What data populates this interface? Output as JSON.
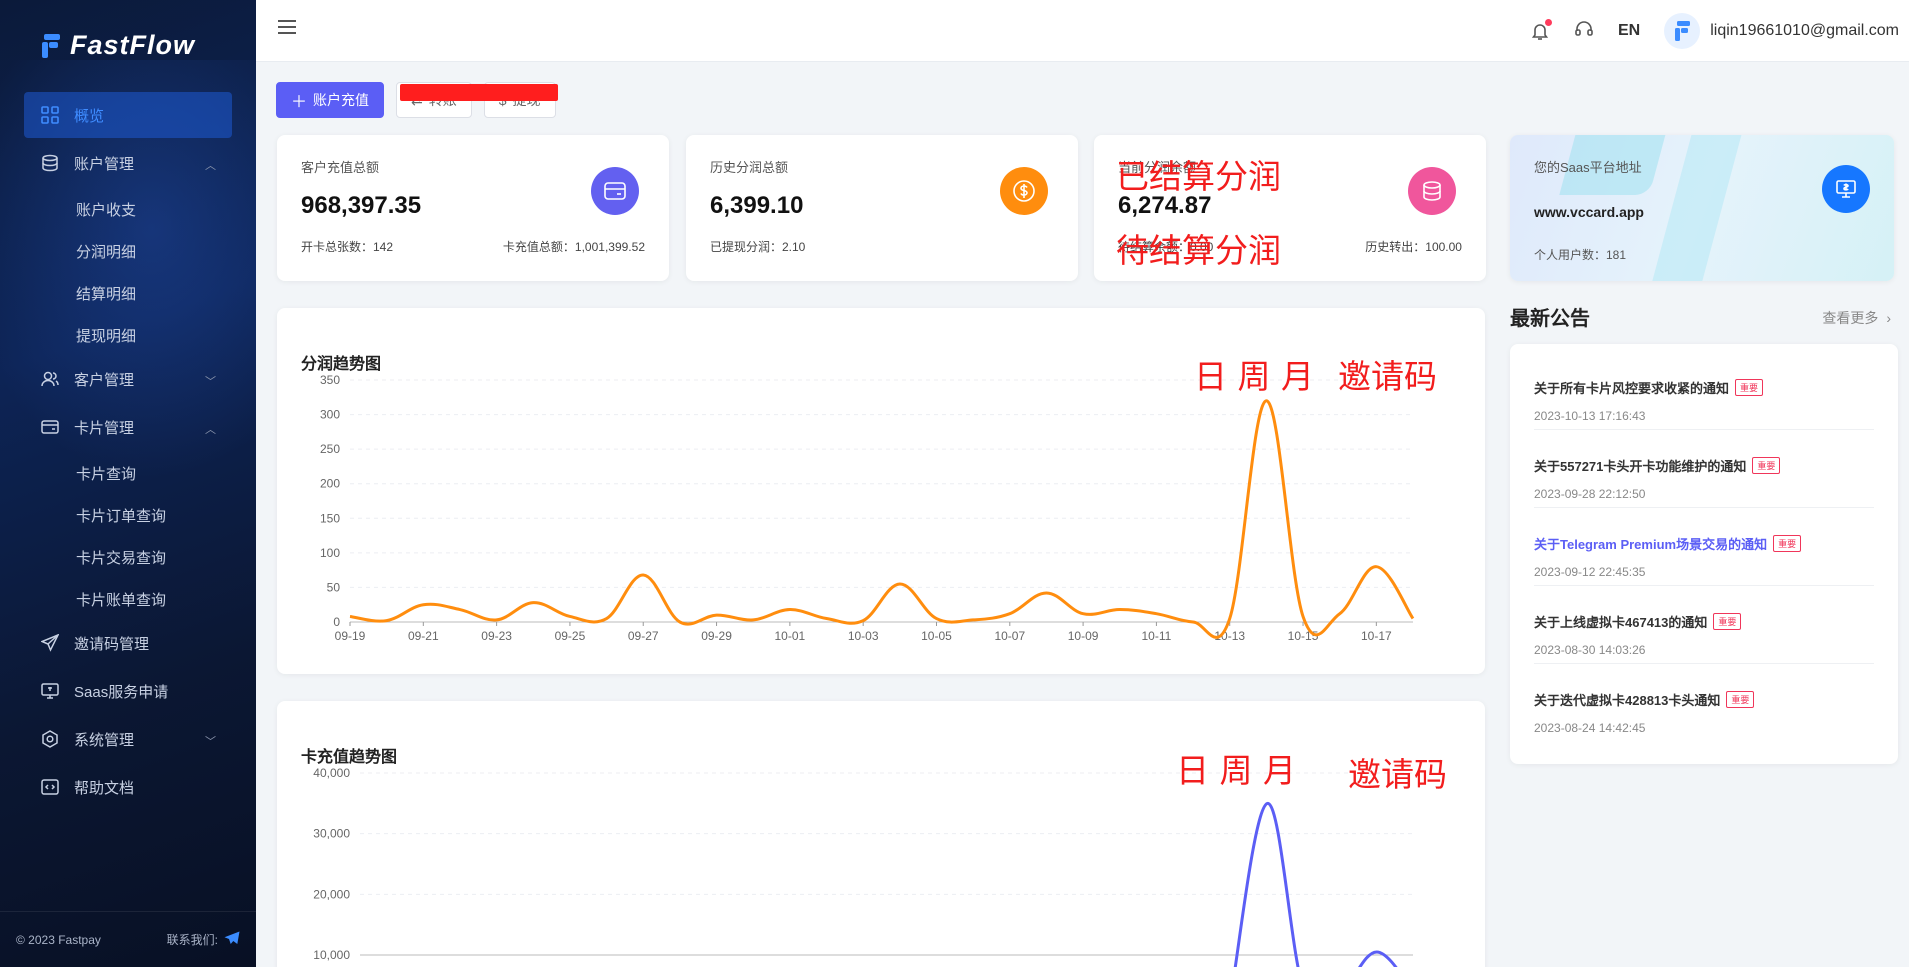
{
  "brand": {
    "name": "FastFlow"
  },
  "sidebar": {
    "items": [
      {
        "label": "概览",
        "icon": "dashboard-icon"
      },
      {
        "label": "账户管理",
        "icon": "database-icon",
        "expanded": true,
        "children": [
          "账户收支",
          "分润明细",
          "结算明细",
          "提现明细"
        ]
      },
      {
        "label": "客户管理",
        "icon": "users-icon",
        "expanded": false
      },
      {
        "label": "卡片管理",
        "icon": "card-icon",
        "expanded": true,
        "children": [
          "卡片查询",
          "卡片订单查询",
          "卡片交易查询",
          "卡片账单查询"
        ]
      },
      {
        "label": "邀请码管理",
        "icon": "send-icon"
      },
      {
        "label": "Saas服务申请",
        "icon": "monitor-icon"
      },
      {
        "label": "系统管理",
        "icon": "settings-icon",
        "expanded": false
      },
      {
        "label": "帮助文档",
        "icon": "code-icon"
      }
    ],
    "footer": {
      "copyright": "© 2023 Fastpay",
      "contact": "联系我们:"
    }
  },
  "topbar": {
    "lang": "EN",
    "user_email": "liqin19661010@gmail.com"
  },
  "actions": {
    "recharge": "账户充值",
    "transfer": "转账",
    "withdraw": "提现"
  },
  "stats": [
    {
      "label": "客户充值总额",
      "value": "968,397.35",
      "foot_left": "开卡总张数：142",
      "foot_right": "卡充值总额：1,001,399.52",
      "color": "#6360f0",
      "icon": "wallet-icon"
    },
    {
      "label": "历史分润总额",
      "value": "6,399.10",
      "foot_left": "已提现分润：2.10",
      "foot_right": "",
      "color": "#ff8d0e",
      "icon": "dollar-icon"
    },
    {
      "label": "当前分润余额",
      "value": "6,274.87",
      "foot_left": "待结算余额：0.00",
      "foot_right": "历史转出：100.00",
      "color": "#f0569c",
      "icon": "coins-icon"
    }
  ],
  "saas": {
    "label": "您的Saas平台地址",
    "url": "www.vccard.app",
    "users": "个人用户数：181"
  },
  "annotations": {
    "settled": "已结算分润",
    "pending": "待结算分润",
    "period_1": "日 周 月",
    "invite_1": "邀请码",
    "period_2": "日 周 月",
    "invite_2": "邀请码"
  },
  "notices": {
    "title": "最新公告",
    "more": "查看更多",
    "items": [
      {
        "title": "关于所有卡片风控要求收紧的通知",
        "tag": "重要",
        "date": "2023-10-13 17:16:43",
        "highlight": false
      },
      {
        "title": "关于557271卡头开卡功能维护的通知",
        "tag": "重要",
        "date": "2023-09-28 22:12:50",
        "highlight": false
      },
      {
        "title": "关于Telegram Premium场景交易的通知",
        "tag": "重要",
        "date": "2023-09-12 22:45:35",
        "highlight": true
      },
      {
        "title": "关于上线虚拟卡467413的通知",
        "tag": "重要",
        "date": "2023-08-30 14:03:26",
        "highlight": false
      },
      {
        "title": "关于迭代虚拟卡428813卡头通知",
        "tag": "重要",
        "date": "2023-08-24 14:42:45",
        "highlight": false
      }
    ]
  },
  "chart_data": [
    {
      "type": "line",
      "title": "分润趋势图",
      "color": "#ff8d0e",
      "ylim": [
        0,
        350
      ],
      "yticks": [
        0,
        50,
        100,
        150,
        200,
        250,
        300,
        350
      ],
      "xticks": [
        "09-19",
        "09-21",
        "09-23",
        "09-25",
        "09-27",
        "09-29",
        "10-01",
        "10-03",
        "10-05",
        "10-07",
        "10-09",
        "10-11",
        "10-13",
        "10-15",
        "10-17"
      ],
      "x": [
        "09-19",
        "09-20",
        "09-21",
        "09-22",
        "09-23",
        "09-24",
        "09-25",
        "09-26",
        "09-27",
        "09-28",
        "09-29",
        "09-30",
        "10-01",
        "10-02",
        "10-03",
        "10-04",
        "10-05",
        "10-06",
        "10-07",
        "10-08",
        "10-09",
        "10-10",
        "10-11",
        "10-12",
        "10-13",
        "10-14",
        "10-15",
        "10-16",
        "10-17",
        "10-18"
      ],
      "values": [
        8,
        2,
        25,
        18,
        3,
        28,
        8,
        5,
        68,
        0,
        10,
        3,
        18,
        5,
        2,
        55,
        5,
        3,
        12,
        42,
        12,
        18,
        12,
        0,
        5,
        320,
        8,
        12,
        80,
        5
      ]
    },
    {
      "type": "line",
      "title": "卡充值趋势图",
      "color": "#5b5ef5",
      "ylim": [
        10000,
        40000
      ],
      "yticks": [
        10000,
        20000,
        30000,
        40000
      ],
      "ytick_labels": [
        "10,000",
        "20,000",
        "30,000",
        "40,000"
      ],
      "x": [
        "09-19",
        "09-20",
        "09-21",
        "09-22",
        "09-23",
        "09-24",
        "09-25",
        "09-26",
        "09-27",
        "09-28",
        "09-29",
        "09-30",
        "10-01",
        "10-02",
        "10-03",
        "10-04",
        "10-05",
        "10-06",
        "10-07",
        "10-08",
        "10-09",
        "10-10",
        "10-11",
        "10-12",
        "10-13",
        "10-14",
        "10-15",
        "10-16",
        "10-17",
        "10-18"
      ],
      "values": [
        null,
        null,
        null,
        null,
        null,
        null,
        null,
        null,
        null,
        null,
        null,
        null,
        null,
        null,
        null,
        null,
        null,
        null,
        null,
        null,
        null,
        null,
        null,
        null,
        0,
        35000,
        0,
        0,
        10500,
        0
      ]
    }
  ]
}
